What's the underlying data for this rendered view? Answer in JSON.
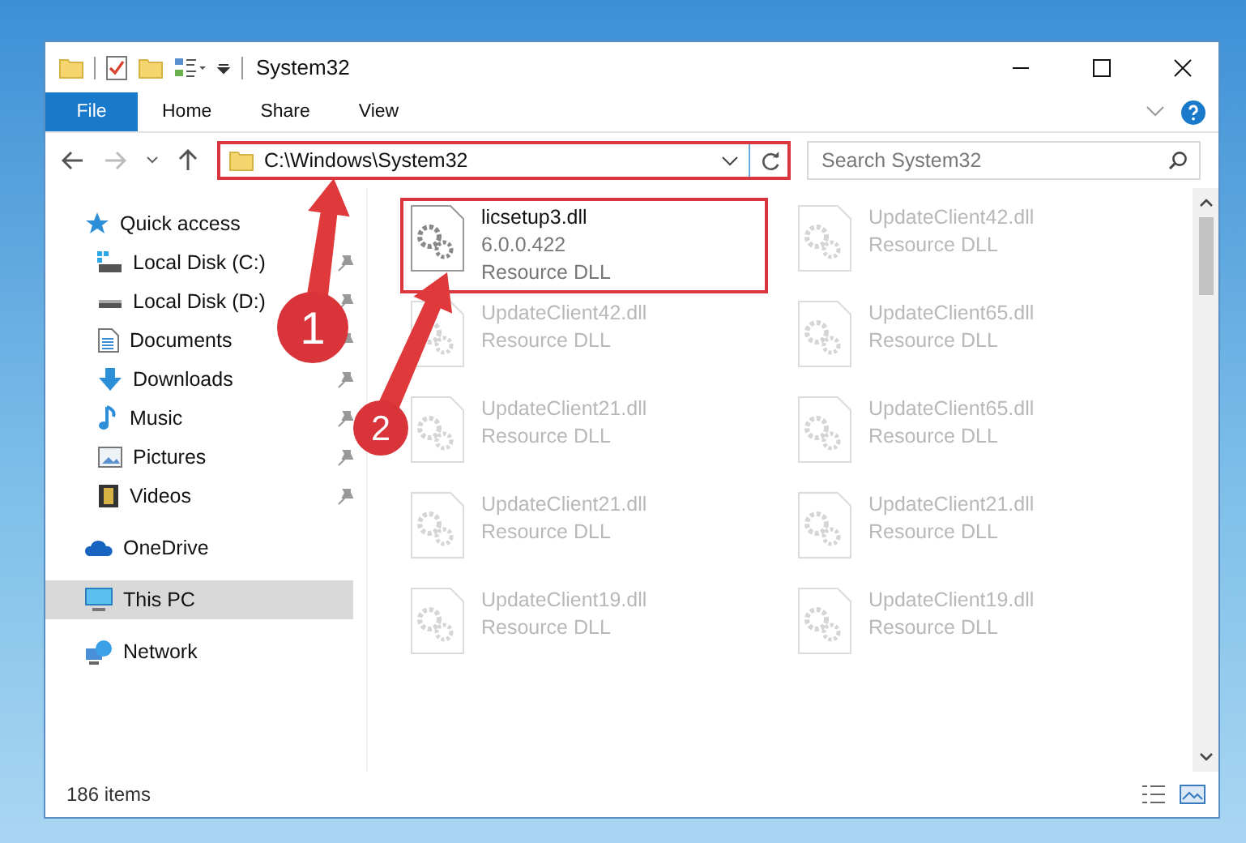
{
  "window": {
    "title": "System32"
  },
  "ribbon_tabs": [
    {
      "label": "File",
      "kind": "file"
    },
    {
      "label": "Home",
      "kind": "tab"
    },
    {
      "label": "Share",
      "kind": "tab"
    },
    {
      "label": "View",
      "kind": "tab"
    }
  ],
  "address_bar": {
    "path": "C:\\Windows\\System32",
    "highlighted": true
  },
  "search": {
    "placeholder": "Search System32"
  },
  "sidebar": {
    "items": [
      {
        "label": "Quick access",
        "kind": "star",
        "selected": false,
        "pinned": false,
        "children": [
          {
            "label": "Local Disk (C:)",
            "kind": "disk-c",
            "selected": false,
            "pinned": true
          },
          {
            "label": "Local Disk (D:)",
            "kind": "disk",
            "selected": false,
            "pinned": true
          },
          {
            "label": "Documents",
            "kind": "documents",
            "selected": false,
            "pinned": true
          },
          {
            "label": "Downloads",
            "kind": "downloads",
            "selected": false,
            "pinned": true
          },
          {
            "label": "Music",
            "kind": "music",
            "selected": false,
            "pinned": true
          },
          {
            "label": "Pictures",
            "kind": "pictures",
            "selected": false,
            "pinned": true
          },
          {
            "label": "Videos",
            "kind": "videos",
            "selected": false,
            "pinned": true
          }
        ]
      },
      {
        "label": "OneDrive",
        "kind": "cloud",
        "selected": false,
        "pinned": false
      },
      {
        "label": "This PC",
        "kind": "pc",
        "selected": true,
        "pinned": false
      },
      {
        "label": "Network",
        "kind": "network",
        "selected": false,
        "pinned": false
      }
    ]
  },
  "files": [
    {
      "name": "licsetup3.dll",
      "version": "6.0.0.422",
      "type": "Resource DLL",
      "dimmed": false,
      "highlighted": true
    },
    {
      "name": "UpdateClient42.dll",
      "type": "Resource DLL",
      "dimmed": true,
      "highlighted": false
    },
    {
      "name": "UpdateClient42.dll",
      "type": "Resource DLL",
      "dimmed": true,
      "highlighted": false
    },
    {
      "name": "UpdateClient65.dll",
      "type": "Resource DLL",
      "dimmed": true,
      "highlighted": false
    },
    {
      "name": "UpdateClient21.dll",
      "type": "Resource DLL",
      "dimmed": true,
      "highlighted": false
    },
    {
      "name": "UpdateClient65.dll",
      "type": "Resource DLL",
      "dimmed": true,
      "highlighted": false
    },
    {
      "name": "UpdateClient21.dll",
      "type": "Resource DLL",
      "dimmed": true,
      "highlighted": false
    },
    {
      "name": "UpdateClient21.dll",
      "type": "Resource DLL",
      "dimmed": true,
      "highlighted": false
    },
    {
      "name": "UpdateClient19.dll",
      "type": "Resource DLL",
      "dimmed": true,
      "highlighted": false
    },
    {
      "name": "UpdateClient19.dll",
      "type": "Resource DLL",
      "dimmed": true,
      "highlighted": false
    }
  ],
  "status_bar": {
    "item_count": "186 items"
  },
  "callouts": [
    {
      "number": "1"
    },
    {
      "number": "2"
    }
  ]
}
